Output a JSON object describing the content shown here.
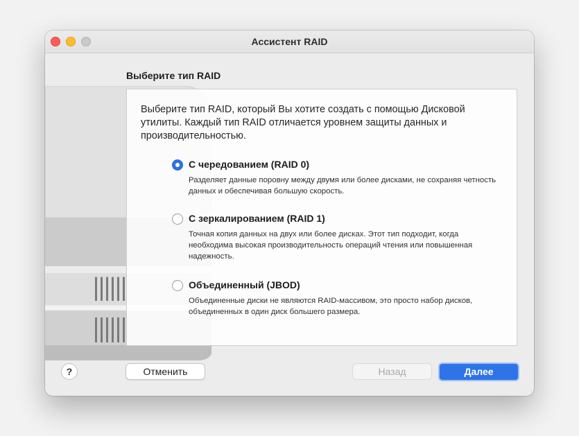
{
  "window": {
    "title": "Ассистент RAID",
    "heading": "Выберите тип RAID"
  },
  "intro": "Выберите тип RAID, который Вы хотите создать с помощью Дисковой утилиты. Каждый тип RAID отличается уровнем защиты данных и производительностью.",
  "options": [
    {
      "title": "С чередованием (RAID 0)",
      "description": "Разделяет данные поровну между двумя или более дисками, не сохраняя четность данных и обеспечивая большую скорость.",
      "selected": true
    },
    {
      "title": "С зеркалированием (RAID 1)",
      "description": "Точная копия данных на двух или более дисках. Этот тип подходит, когда необходима высокая производительность операций чтения или повышенная надежность.",
      "selected": false
    },
    {
      "title": "Объединенный (JBOD)",
      "description": "Объединенные диски не являются RAID-массивом, это просто набор дисков, объединенных в один диск большего размера.",
      "selected": false
    }
  ],
  "buttons": {
    "help": "?",
    "cancel": "Отменить",
    "back": "Назад",
    "next": "Далее"
  },
  "colors": {
    "accent": "#2f74e6",
    "close": "#fe5f57",
    "minimize": "#febc2e",
    "zoom": "#c9c9c9"
  },
  "icons": {
    "help": "question-mark-icon",
    "illustration": "drive-array-illustration"
  }
}
